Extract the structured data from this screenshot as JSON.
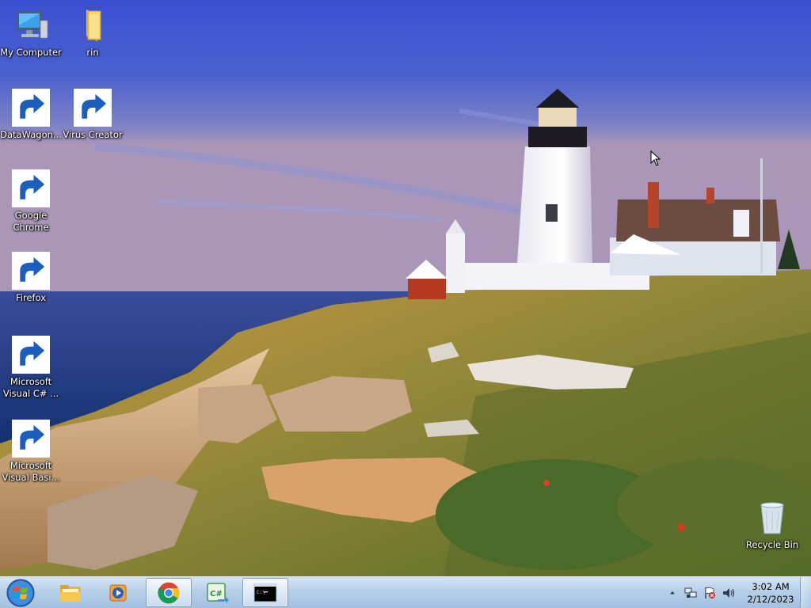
{
  "desktop": {
    "icons": [
      {
        "label": "My Computer",
        "icon": "computer-icon"
      },
      {
        "label": "rin",
        "icon": "folder-icon"
      },
      {
        "label": "DataWagon...",
        "icon": "datawagon-icon"
      },
      {
        "label": "Virus Creator",
        "icon": "virus-creator-icon"
      },
      {
        "label": "Google Chrome",
        "icon": "chrome-icon"
      },
      {
        "label": "Firefox",
        "icon": "firefox-icon"
      },
      {
        "label": "Microsoft Visual C# ...",
        "icon": "visual-csharp-icon"
      },
      {
        "label": "Microsoft Visual Basi...",
        "icon": "visual-basic-icon"
      },
      {
        "label": "Recycle Bin",
        "icon": "recycle-bin-icon"
      }
    ]
  },
  "taskbar": {
    "start": {
      "icon": "windows-start-icon"
    },
    "pinned": [
      {
        "name": "File Explorer",
        "icon": "explorer-icon",
        "active": false
      },
      {
        "name": "Windows Media Player",
        "icon": "media-player-icon",
        "active": false
      },
      {
        "name": "Google Chrome",
        "icon": "chrome-icon",
        "active": true
      },
      {
        "name": "Visual C#",
        "icon": "visual-csharp-icon",
        "active": false
      },
      {
        "name": "Command Prompt",
        "icon": "cmd-icon",
        "active": true
      }
    ],
    "tray": {
      "icons": [
        "chevron-up-icon",
        "network-icon",
        "action-center-flag-icon",
        "volume-icon"
      ],
      "time": "3:02 AM",
      "date": "2/12/2023"
    }
  },
  "colors": {
    "taskbar": "#b4cde6",
    "sky": "#4a5fc9",
    "sea": "#2a4a9a"
  }
}
